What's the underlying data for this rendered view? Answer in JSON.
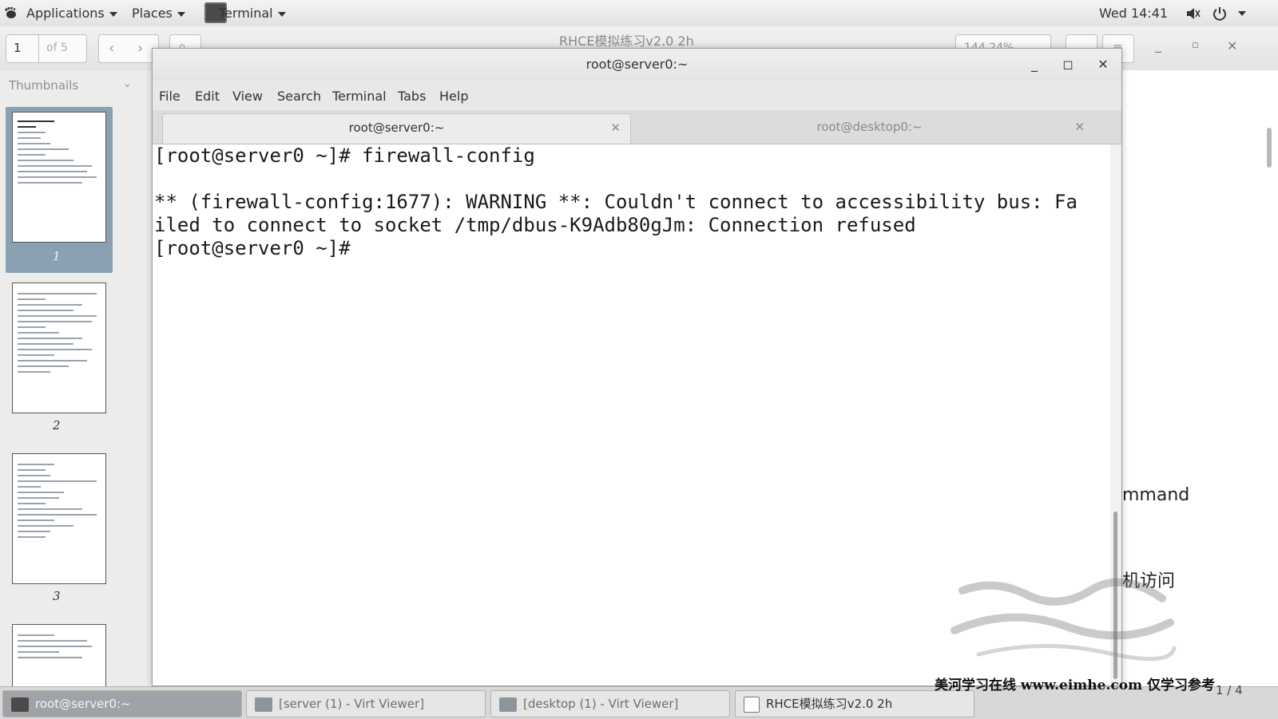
{
  "topbar": {
    "applications_label": "Applications",
    "places_label": "Places",
    "app_label": "Terminal",
    "clock": "Wed 14:41"
  },
  "viewer": {
    "page_number": "1",
    "page_of": "of 5",
    "title": "RHCE模拟练习v2.0 2h",
    "zoom": "144.24%",
    "sidebar_label": "Thumbnails",
    "thumbnails": [
      "1",
      "2",
      "3"
    ],
    "doc_fragments": [
      "mmand",
      "机访问"
    ],
    "page_indicator": "1 / 4"
  },
  "terminal": {
    "window_title": "root@server0:~",
    "menu": [
      "File",
      "Edit",
      "View",
      "Search",
      "Terminal",
      "Tabs",
      "Help"
    ],
    "tabs": [
      {
        "label": "root@server0:~",
        "active": true
      },
      {
        "label": "root@desktop0:~",
        "active": false
      }
    ],
    "lines": [
      "[root@server0 ~]# firewall-config",
      "",
      "** (firewall-config:1677): WARNING **: Couldn't connect to accessibility bus: Fa",
      "iled to connect to socket /tmp/dbus-K9Adb80gJm: Connection refused",
      "[root@server0 ~]# "
    ]
  },
  "taskbar": {
    "items": [
      {
        "label": "root@server0:~",
        "active": true
      },
      {
        "label": "[server (1) - Virt Viewer]",
        "active": false
      },
      {
        "label": "[desktop (1) - Virt Viewer]",
        "active": false
      },
      {
        "label": "RHCE模拟练习v2.0 2h",
        "active": false
      }
    ]
  },
  "watermark": {
    "text": "美河学习在线 www.eimhe.com 仅学习参考"
  }
}
